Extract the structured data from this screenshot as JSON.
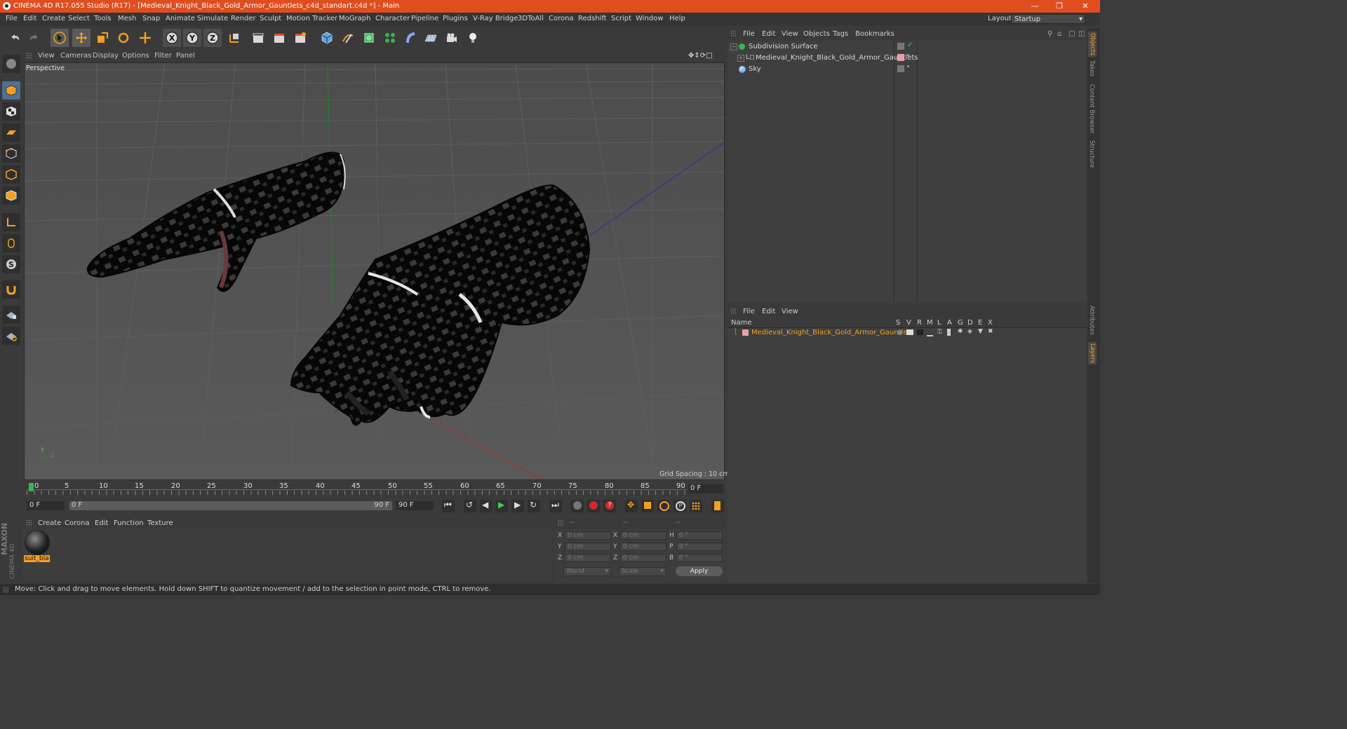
{
  "app": {
    "title": "CINEMA 4D R17.055 Studio (R17) - [Medieval_Knight_Black_Gold_Armor_Gauntlets_c4d_standart.c4d *] - Main",
    "window_buttons": [
      "—",
      "❐",
      "✕"
    ]
  },
  "menu": [
    "File",
    "Edit",
    "Create",
    "Select",
    "Tools",
    "Mesh",
    "Snap",
    "Animate",
    "Simulate",
    "Render",
    "Sculpt",
    "Motion Tracker",
    "MoGraph",
    "Character",
    "Pipeline",
    "Plugins",
    "V-Ray Bridge",
    "3DToAll",
    "Corona",
    "Redshift",
    "Script",
    "Window",
    "Help"
  ],
  "layout": {
    "label": "Layout:",
    "value": "Startup"
  },
  "toolbar": {
    "axis": [
      "X",
      "Y",
      "Z"
    ]
  },
  "viewport": {
    "menu": [
      "View",
      "Cameras",
      "Display",
      "Options",
      "Filter",
      "Panel"
    ],
    "camera_label": "Perspective",
    "grid_spacing": "Grid Spacing : 10 cm",
    "axis_labels": [
      "y",
      "z"
    ]
  },
  "timeline": {
    "ticks": [
      "0",
      "5",
      "10",
      "15",
      "20",
      "25",
      "30",
      "35",
      "40",
      "45",
      "50",
      "55",
      "60",
      "65",
      "70",
      "75",
      "80",
      "85",
      "90"
    ],
    "current_frame": "0 F",
    "start_field": "0 F",
    "slider_start": "0 F",
    "slider_end": "90 F",
    "end_field": "90 F"
  },
  "material_panel": {
    "menu": [
      "Create",
      "Corona",
      "Edit",
      "Function",
      "Texture"
    ],
    "material_name": "suit_bla",
    "brand": [
      "MAXON",
      "CINEMA 4D"
    ]
  },
  "coordinates": {
    "headers": [
      "--",
      "--",
      "--"
    ],
    "rows": [
      {
        "a": "X",
        "av": "0 cm",
        "b": "X",
        "bv": "0 cm",
        "c": "H",
        "cv": "0 °"
      },
      {
        "a": "Y",
        "av": "0 cm",
        "b": "Y",
        "bv": "0 cm",
        "c": "P",
        "cv": "0 °"
      },
      {
        "a": "Z",
        "av": "0 cm",
        "b": "Z",
        "bv": "0 cm",
        "c": "B",
        "cv": "0 °"
      }
    ],
    "mode": "World",
    "scale": "Scale",
    "apply": "Apply"
  },
  "objects_panel": {
    "menu": [
      "File",
      "Edit",
      "View",
      "Objects",
      "Tags",
      "Bookmarks"
    ],
    "items": [
      {
        "name": "Subdivision Surface",
        "color": "#39b54a"
      },
      {
        "name": "Medieval_Knight_Black_Gold_Armor_Gauntlets",
        "color": "#b0b0b0"
      },
      {
        "name": "Sky",
        "color": "#7ab0e0"
      }
    ]
  },
  "layers_panel": {
    "menu": [
      "File",
      "Edit",
      "View"
    ],
    "columns": [
      "Name",
      "S",
      "V",
      "R",
      "M",
      "L",
      "A",
      "G",
      "D",
      "E",
      "X"
    ],
    "layer_name": "Medieval_Knight_Black_Gold_Armor_Gauntlets",
    "layer_color": "#f4a020"
  },
  "right_tabs": [
    "Objects",
    "Takes",
    "Content Browser",
    "Structure",
    "Attributes",
    "Layers"
  ],
  "status": "Move: Click and drag to move elements. Hold down SHIFT to quantize movement / add to the selection in point mode, CTRL to remove.",
  "colors": {
    "accent": "#e04e1f",
    "highlight": "#f4a020",
    "selected": "#5a7fa8"
  }
}
